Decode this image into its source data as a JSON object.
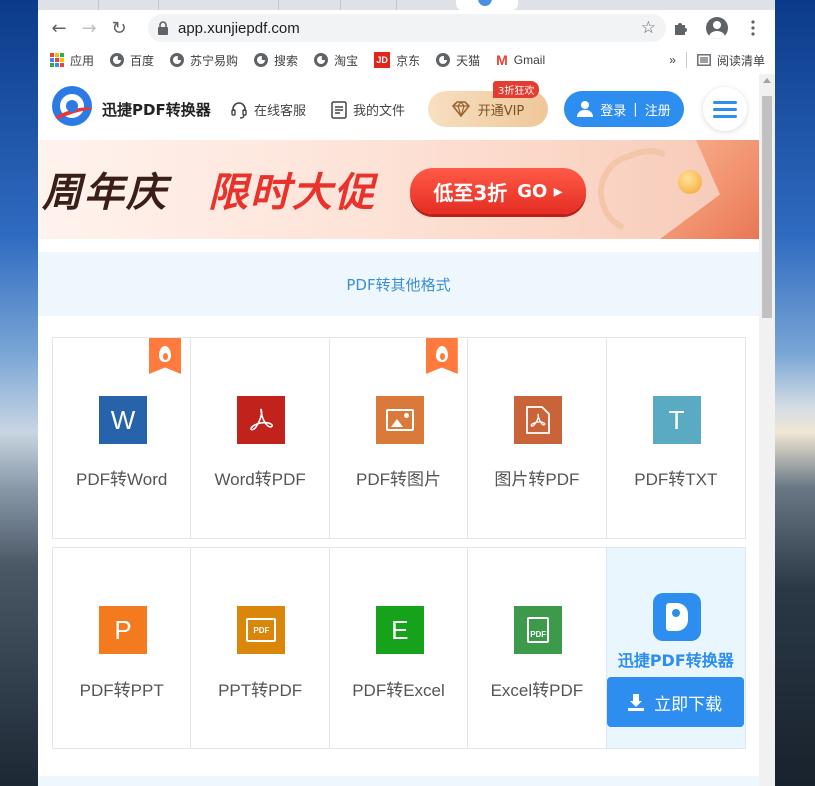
{
  "browser": {
    "url": "app.xunjiepdf.com",
    "bookmarks": [
      {
        "label": "应用",
        "icon": "apps-icon"
      },
      {
        "label": "百度",
        "icon": "globe-icon"
      },
      {
        "label": "苏宁易购",
        "icon": "globe-icon"
      },
      {
        "label": "搜索",
        "icon": "globe-icon"
      },
      {
        "label": "淘宝",
        "icon": "globe-icon"
      },
      {
        "label": "京东",
        "icon": "jd-icon"
      },
      {
        "label": "天猫",
        "icon": "globe-icon"
      },
      {
        "label": "Gmail",
        "icon": "gmail-icon"
      }
    ],
    "overflow": "»",
    "reading_list": "阅读清单"
  },
  "site": {
    "brand": "迅捷PDF转换器",
    "support": "在线客服",
    "my_files": "我的文件",
    "vip_label": "开通VIP",
    "vip_badge": "3折狂欢",
    "login": "登录",
    "register": "注册",
    "accent": "#2d8ef0"
  },
  "banner": {
    "part1": "周年庆",
    "part2": "限时大促",
    "cta": "低至3折",
    "go": "GO"
  },
  "section": {
    "title": "PDF转其他格式"
  },
  "tools_row1": [
    {
      "label": "PDF转Word",
      "glyph": "W",
      "color": "#2763ab",
      "hot": true
    },
    {
      "label": "Word转PDF",
      "glyph": "",
      "color": "#c1221b",
      "hot": false
    },
    {
      "label": "PDF转图片",
      "glyph": "",
      "color": "#d97a3a",
      "hot": true
    },
    {
      "label": "图片转PDF",
      "glyph": "",
      "color": "#c9633a",
      "hot": false
    },
    {
      "label": "PDF转TXT",
      "glyph": "T",
      "color": "#5aaac4",
      "hot": false
    }
  ],
  "tools_row2": [
    {
      "label": "PDF转PPT",
      "glyph": "P",
      "color": "#f47a1f"
    },
    {
      "label": "PPT转PDF",
      "glyph": "PDF",
      "color": "#d9860b"
    },
    {
      "label": "PDF转Excel",
      "glyph": "E",
      "color": "#16a21a"
    },
    {
      "label": "Excel转PDF",
      "glyph": "PDF",
      "color": "#3d9a4a"
    }
  ],
  "promo": {
    "title": "迅捷PDF转换器",
    "download": "立即下载"
  }
}
